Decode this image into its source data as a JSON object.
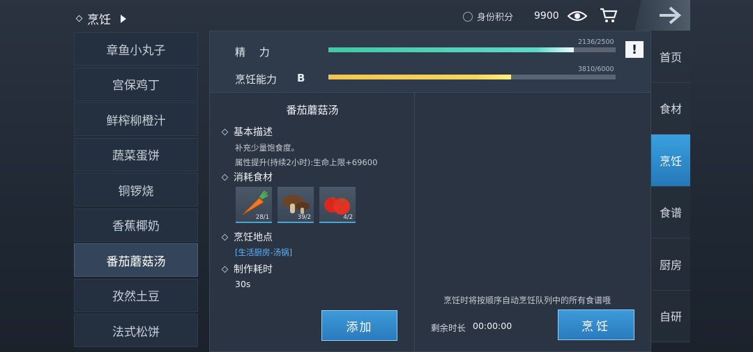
{
  "header": {
    "breadcrumb": "烹饪",
    "identity_label": "身份积分",
    "identity_score": "9900"
  },
  "recipes": [
    {
      "label": "章鱼小丸子"
    },
    {
      "label": "宫保鸡丁"
    },
    {
      "label": "鲜榨柳橙汁"
    },
    {
      "label": "蔬菜蛋饼"
    },
    {
      "label": "铜锣烧"
    },
    {
      "label": "香蕉椰奶"
    },
    {
      "label": "番茄蘑菇汤",
      "active": true
    },
    {
      "label": "孜然土豆"
    },
    {
      "label": "法式松饼"
    }
  ],
  "stats": {
    "energy_label": "精　 力",
    "energy_text": "2136/2500",
    "energy_fraction": 0.8544,
    "cooking_label": "烹饪能力",
    "cooking_grade": "B",
    "cooking_text": "3810/6000",
    "cooking_fraction": 0.635,
    "colors": {
      "energy": "#3fc9a4",
      "cooking": "#f2c64d"
    }
  },
  "detail": {
    "title": "番茄蘑菇汤",
    "basic_header": "基本描述",
    "basic_line1": "补充少量饱食度。",
    "basic_line2": "属性提升(持续2小时):生命上限+69600",
    "ingredients_header": "消耗食材",
    "ingredients": [
      {
        "icon": "carrot-icon",
        "count": "28/1"
      },
      {
        "icon": "mushroom-icon",
        "count": "39/2"
      },
      {
        "icon": "tomato-icon",
        "count": "4/2"
      }
    ],
    "location_header": "烹饪地点",
    "location": "[生活厨房-汤锅]",
    "time_header": "制作耗时",
    "time": "30s",
    "add_button": "添加"
  },
  "queue": {
    "hint": "烹饪时将按顺序自动烹饪队列中的所有食谱哦",
    "remaining_label": "剩余时长",
    "remaining_time": "00:00:00",
    "cook_button": "烹饪"
  },
  "nav": [
    {
      "label": "首页"
    },
    {
      "label": "食材"
    },
    {
      "label": "烹饪",
      "active": true
    },
    {
      "label": "食谱"
    },
    {
      "label": "厨房"
    },
    {
      "label": "自研"
    }
  ]
}
